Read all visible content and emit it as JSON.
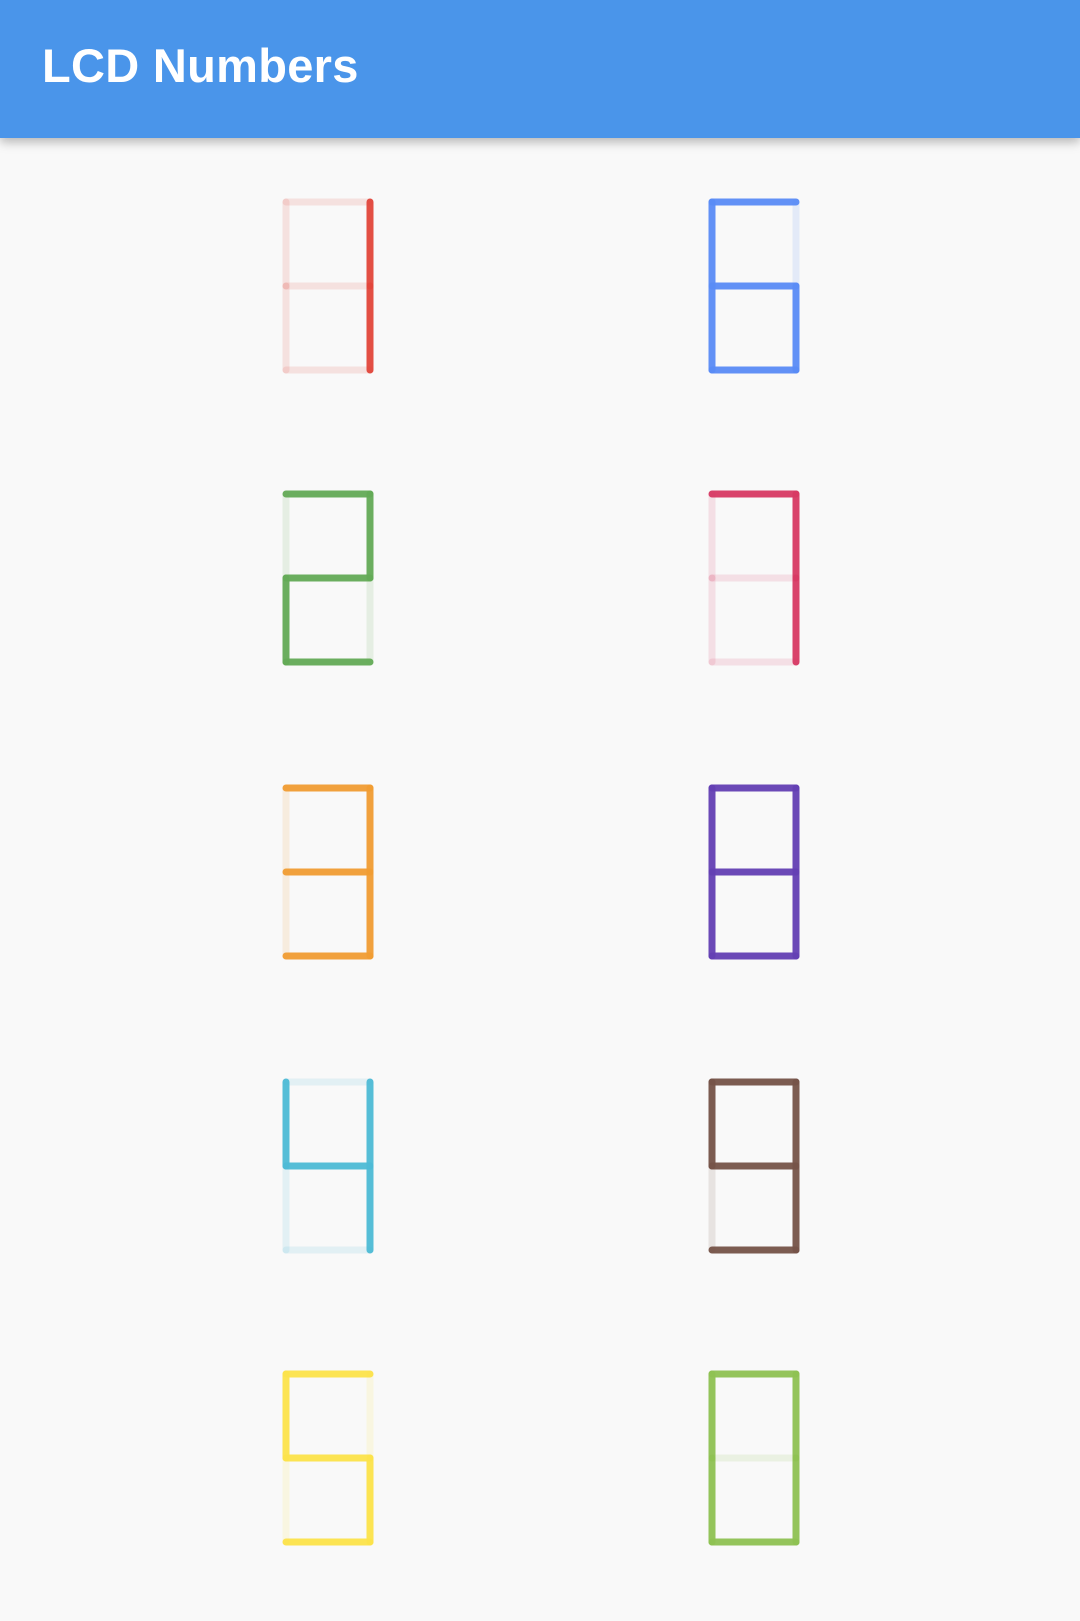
{
  "app_bar": {
    "title": "LCD Numbers",
    "background": "#4a95ea"
  },
  "digits": [
    {
      "value": 1,
      "color": "#e2463b"
    },
    {
      "value": 2,
      "color": "#64ab57"
    },
    {
      "value": 3,
      "color": "#f19d33"
    },
    {
      "value": 4,
      "color": "#4ebbd6"
    },
    {
      "value": 5,
      "color": "#fde34b"
    },
    {
      "value": 6,
      "color": "#5a8cf6"
    },
    {
      "value": 7,
      "color": "#d83a64"
    },
    {
      "value": 8,
      "color": "#6440b4"
    },
    {
      "value": 9,
      "color": "#765449"
    },
    {
      "value": 0,
      "color": "#8fc253"
    }
  ]
}
